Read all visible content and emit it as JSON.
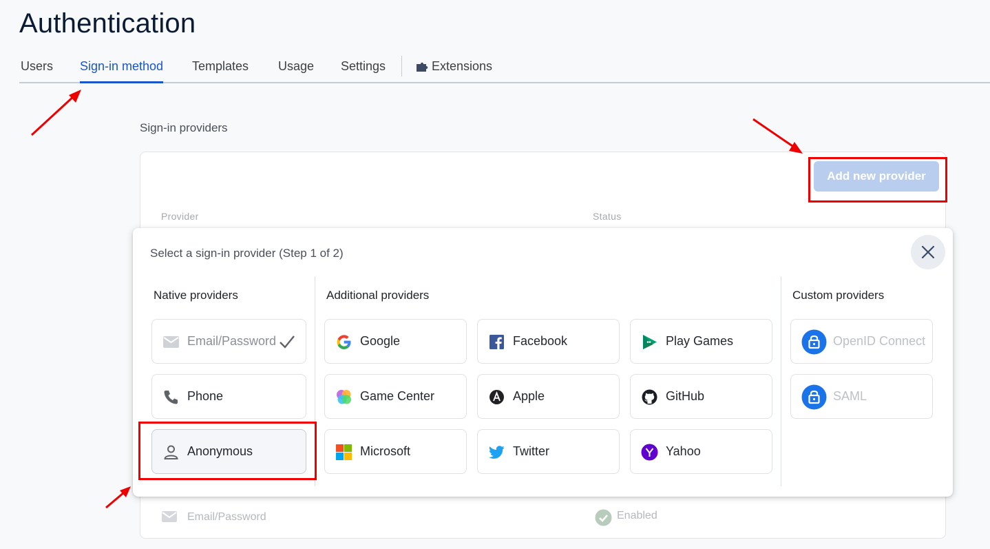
{
  "page": {
    "title": "Authentication"
  },
  "tabs": [
    {
      "label": "Users"
    },
    {
      "label": "Sign-in method"
    },
    {
      "label": "Templates"
    },
    {
      "label": "Usage"
    },
    {
      "label": "Settings"
    },
    {
      "label": "Extensions"
    }
  ],
  "active_tab": "Sign-in method",
  "section": {
    "label": "Sign-in providers"
  },
  "providers_table": {
    "add_button": "Add new provider",
    "columns": [
      "Provider",
      "Status"
    ],
    "rows": [
      {
        "provider": "Email/Password",
        "status": "Enabled"
      }
    ]
  },
  "modal": {
    "title": "Select a sign-in provider (Step 1 of 2)",
    "native": {
      "heading": "Native providers",
      "items": [
        {
          "label": "Email/Password",
          "icon": "mail-icon",
          "state": "already-enabled"
        },
        {
          "label": "Phone",
          "icon": "phone-icon"
        },
        {
          "label": "Anonymous",
          "icon": "person-icon",
          "state": "selected"
        }
      ]
    },
    "additional": {
      "heading": "Additional providers",
      "items": [
        {
          "label": "Google",
          "icon": "google-icon"
        },
        {
          "label": "Facebook",
          "icon": "facebook-icon"
        },
        {
          "label": "Play Games",
          "icon": "play-games-icon"
        },
        {
          "label": "Game Center",
          "icon": "game-center-icon"
        },
        {
          "label": "Apple",
          "icon": "apple-icon"
        },
        {
          "label": "GitHub",
          "icon": "github-icon"
        },
        {
          "label": "Microsoft",
          "icon": "microsoft-icon"
        },
        {
          "label": "Twitter",
          "icon": "twitter-icon"
        },
        {
          "label": "Yahoo",
          "icon": "yahoo-icon"
        }
      ]
    },
    "custom": {
      "heading": "Custom providers",
      "items": [
        {
          "label": "OpenID Connect",
          "icon": "lock-icon",
          "state": "disabled"
        },
        {
          "label": "SAML",
          "icon": "lock-icon",
          "state": "disabled"
        }
      ]
    }
  },
  "colors": {
    "accent": "#1a56c9",
    "annotation_red": "#ee0000",
    "button_disabled_bg": "#b9cdef"
  }
}
